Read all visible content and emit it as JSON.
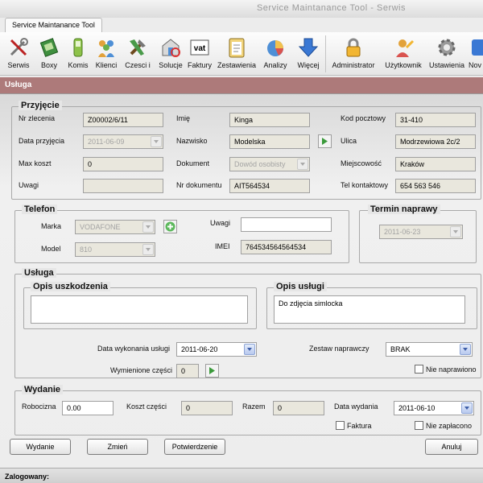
{
  "app": {
    "title": "Service Maintanance Tool - Serwis",
    "ribbon_tab": "Service Maintanance Tool"
  },
  "toolbar": {
    "items": [
      {
        "label": "Serwis",
        "icon": "tools-icon"
      },
      {
        "label": "Boxy",
        "icon": "box-icon"
      },
      {
        "label": "Komis",
        "icon": "phone-icon"
      },
      {
        "label": "Klienci",
        "icon": "clients-icon"
      },
      {
        "label": "Czesci i",
        "icon": "parts-icon"
      },
      {
        "label": "Solucje",
        "icon": "solutions-icon"
      },
      {
        "label": "Faktury",
        "icon": "invoice-vat-icon",
        "glyph": "vat"
      },
      {
        "label": "Zestawienia",
        "icon": "clipboard-icon"
      },
      {
        "label": "Analizy",
        "icon": "analysis-pie-icon"
      },
      {
        "label": "Więcej",
        "icon": "down-arrow-icon"
      },
      {
        "label": "Administrator",
        "icon": "lock-icon"
      },
      {
        "label": "Użytkownik",
        "icon": "user-key-icon"
      },
      {
        "label": "Ustawienia",
        "icon": "gear-icon"
      },
      {
        "label": "Nov",
        "icon": "next-icon"
      }
    ]
  },
  "dialog": {
    "title": "Usługa",
    "przyjecie": {
      "title": "Przyjęcie",
      "nr_zlecenia": {
        "label": "Nr zlecenia",
        "value": "Z00002/6/11"
      },
      "data_przyjecia": {
        "label": "Data przyjęcia",
        "value": "2011-06-09"
      },
      "max_koszt": {
        "label": "Max koszt",
        "value": "0"
      },
      "uwagi": {
        "label": "Uwagi",
        "value": ""
      },
      "imie": {
        "label": "Imię",
        "value": "Kinga"
      },
      "nazwisko": {
        "label": "Nazwisko",
        "value": "Modelska"
      },
      "dokument": {
        "label": "Dokument",
        "value": "Dowód osobisty"
      },
      "nr_dokumentu": {
        "label": "Nr dokumentu",
        "value": "AIT564534"
      },
      "kod_pocztowy": {
        "label": "Kod pocztowy",
        "value": "31-410"
      },
      "ulica": {
        "label": "Ulica",
        "value": "Modrzewiowa 2c/2"
      },
      "miejscowosc": {
        "label": "Miejscowość",
        "value": "Kraków"
      },
      "tel_kontaktowy": {
        "label": "Tel kontaktowy",
        "value": "654 563 546"
      }
    },
    "telefon": {
      "title": "Telefon",
      "marka": {
        "label": "Marka",
        "value": "VODAFONE"
      },
      "model": {
        "label": "Model",
        "value": "810"
      },
      "uwagi": {
        "label": "Uwagi",
        "value": ""
      },
      "imei": {
        "label": "IMEI",
        "value": "764534564564534"
      }
    },
    "termin": {
      "title": "Termin naprawy",
      "value": "2011-06-23"
    },
    "usluga": {
      "title": "Usługa",
      "opis_uszkodzenia": {
        "title": "Opis uszkodzenia",
        "value": ""
      },
      "opis_uslugi": {
        "title": "Opis usługi",
        "value": "Do zdjęcia simlocka"
      },
      "data_wykonania": {
        "label": "Data wykonania usługi",
        "value": "2011-06-20"
      },
      "wymienione_czesci": {
        "label": "Wymienione części",
        "value": "0"
      },
      "zestaw_naprawczy": {
        "label": "Zestaw naprawczy",
        "value": "BRAK"
      },
      "nie_naprawiono": {
        "label": "Nie naprawiono",
        "checked": false
      }
    },
    "wydanie": {
      "title": "Wydanie",
      "robocizna": {
        "label": "Robocizna",
        "value": "0.00"
      },
      "koszt_czesci": {
        "label": "Koszt części",
        "value": "0"
      },
      "razem": {
        "label": "Razem",
        "value": "0"
      },
      "data_wydania": {
        "label": "Data wydania",
        "value": "2011-06-10"
      },
      "faktura": {
        "label": "Faktura",
        "checked": false
      },
      "nie_zaplacono": {
        "label": "Nie zapłacono",
        "checked": false
      }
    },
    "buttons": {
      "wydanie": "Wydanie",
      "zmien": "Zmień",
      "potwierdzenie": "Potwierdzenie",
      "anuluj": "Anuluj"
    }
  },
  "status": {
    "logged_label": "Zalogowany:"
  },
  "colors": {
    "dialog_title_bg": "#ad7a7a",
    "field_bg": "#e9e7dd",
    "accent_blue": "#3d5ea8"
  }
}
